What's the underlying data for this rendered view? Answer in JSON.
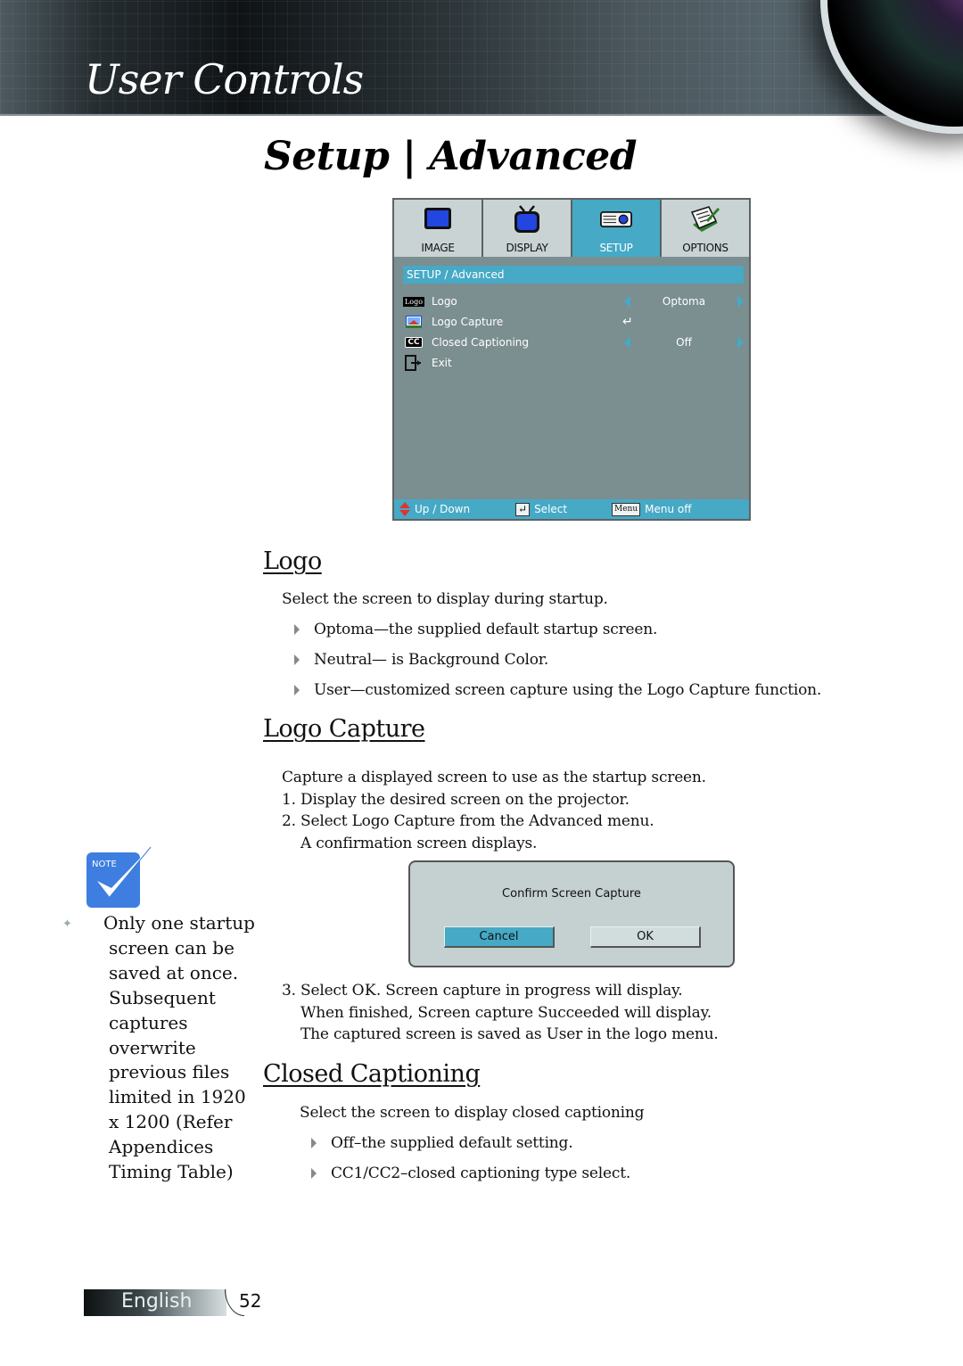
{
  "header": {
    "section_title": "User Controls",
    "page_title": "Setup | Advanced"
  },
  "osd_menu": {
    "tabs": [
      {
        "label": "IMAGE",
        "icon": "monitor-icon",
        "active": false
      },
      {
        "label": "DISPLAY",
        "icon": "tv-icon",
        "active": false
      },
      {
        "label": "SETUP",
        "icon": "projector-icon",
        "active": true
      },
      {
        "label": "OPTIONS",
        "icon": "notepad-icon",
        "active": false
      }
    ],
    "breadcrumb": "SETUP / Advanced",
    "rows": [
      {
        "icon": "logo-icon",
        "icon_text": "Logo",
        "label": "Logo",
        "value": "Optoma",
        "control": "arrows"
      },
      {
        "icon": "logo-capture-icon",
        "label": "Logo Capture",
        "value": "",
        "control": "enter"
      },
      {
        "icon": "cc-icon",
        "icon_text": "CC",
        "label": "Closed Captioning",
        "value": "Off",
        "control": "arrows"
      },
      {
        "icon": "exit-icon",
        "label": "Exit",
        "value": "",
        "control": "none"
      }
    ],
    "footer": {
      "updown_label": "Up / Down",
      "select_label": "Select",
      "menu_key": "Menu",
      "menu_label": "Menu off"
    },
    "colors": {
      "accent": "#46a9c6",
      "body": "#7b8e90",
      "tab": "#c9d3d4"
    }
  },
  "logo_section": {
    "heading": "Logo",
    "intro": "Select the screen to display during startup.",
    "bullets": [
      "Optoma—the supplied default startup screen.",
      "Neutral— is Background Color.",
      "User—customized screen capture using the Logo Capture function."
    ]
  },
  "logo_capture_section": {
    "heading": "Logo Capture",
    "intro": "Capture a displayed screen to use as the startup screen.",
    "step1": "1. Display the desired screen on the projector.",
    "step2": "2. Select Logo Capture from the Advanced menu.",
    "step2_cont": "A confirmation screen displays.",
    "step3_prefix": "3. Select ",
    "step3_bold": "OK",
    "step3_rest": ". Screen capture in progress will display.",
    "step3_line2": "When finished, Screen capture Succeeded will display.",
    "step3_line3": "The captured screen is saved as User in the logo menu."
  },
  "confirm_dialog": {
    "title": "Confirm Screen Capture",
    "cancel_label": "Cancel",
    "ok_label": "OK"
  },
  "closed_captioning_section": {
    "heading": "Closed Captioning",
    "intro": "Select the screen to display closed captioning",
    "bullets": [
      "Off–the supplied default setting.",
      "CC1/CC2–closed captioning type select."
    ]
  },
  "note": {
    "badge": "NOTE",
    "text": "Only one startup screen can be saved at once. Subsequent captures overwrite previous files limited in 1920 x 1200 (Refer Appendices Timing Table)"
  },
  "footer": {
    "language": "English",
    "page_number": "52"
  }
}
